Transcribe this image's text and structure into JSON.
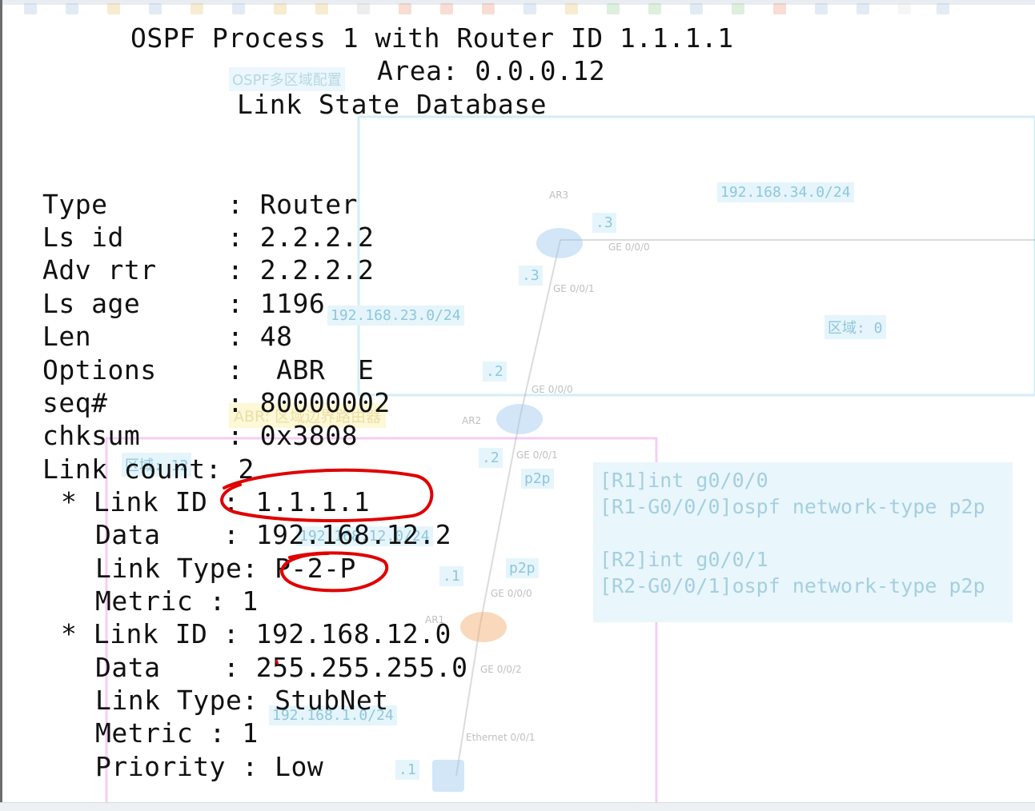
{
  "header": {
    "line1": "OSPF Process 1 with Router ID 1.1.1.1",
    "line2": "Area: 0.0.0.12",
    "line3": "Link State Database"
  },
  "lsa": [
    {
      "label": "Type",
      "sep": ":",
      "value": "Router"
    },
    {
      "label": "Ls id",
      "sep": ":",
      "value": "2.2.2.2"
    },
    {
      "label": "Adv rtr",
      "sep": ":",
      "value": "2.2.2.2"
    },
    {
      "label": "Ls age",
      "sep": ":",
      "value": "1196"
    },
    {
      "label": "Len",
      "sep": ":",
      "value": "48"
    },
    {
      "label": "Options",
      "sep": ":",
      "value": " ABR  E"
    },
    {
      "label": "seq#",
      "sep": ":",
      "value": "80000002"
    },
    {
      "label": "chksum",
      "sep": ":",
      "value": "0x3808"
    },
    {
      "label": "Link count",
      "sep": ":",
      "value": "2"
    }
  ],
  "links": [
    {
      "marker": "*",
      "rows": [
        {
          "label": "Link ID",
          "value": "1.1.1.1"
        },
        {
          "label": "Data",
          "value": "192.168.12.2"
        },
        {
          "label": "Link Type",
          "value": "P-2-P"
        },
        {
          "label": "Metric",
          "value": "1"
        }
      ]
    },
    {
      "marker": "*",
      "rows": [
        {
          "label": "Link ID",
          "value": "192.168.12.0"
        },
        {
          "label": "Data",
          "value": "255.255.255.0"
        },
        {
          "label": "Link Type",
          "value": "StubNet"
        },
        {
          "label": "Metric",
          "value": "1"
        },
        {
          "label": "Priority",
          "value": "Low"
        }
      ]
    }
  ],
  "background": {
    "title_tag": "OSPF多区域配置",
    "area_label": "区域: 0",
    "area_label2": "区域: 12",
    "abr_note": "ABR: 区域边界路由器",
    "routers": [
      "AR3",
      "AR2",
      "AR1"
    ],
    "networks": [
      "192.168.34.0/24",
      "192.168.23.0/24",
      "192.168.12.0/24",
      "192.168.1.0/24"
    ],
    "ifaces": [
      "GE 0/0/0",
      "GE 0/0/1",
      "GE 0/0/0",
      "GE 0/0/1",
      "GE 0/0/0",
      "GE 0/0/2",
      "Ethernet 0/0/1"
    ],
    "hosts": [
      ".3",
      ".3",
      ".2",
      ".2",
      ".1",
      ".1"
    ],
    "p2p": [
      "p2p",
      "p2p"
    ],
    "config": "[R1]int g0/0/0\n[R1-G0/0/0]ospf network-type p2p\n\n[R2]int g0/0/1\n[R2-G0/0/1]ospf network-type p2p"
  },
  "colors": {
    "annotation": "#e00000",
    "text": "#111111",
    "faded": "#9ecbdd"
  }
}
